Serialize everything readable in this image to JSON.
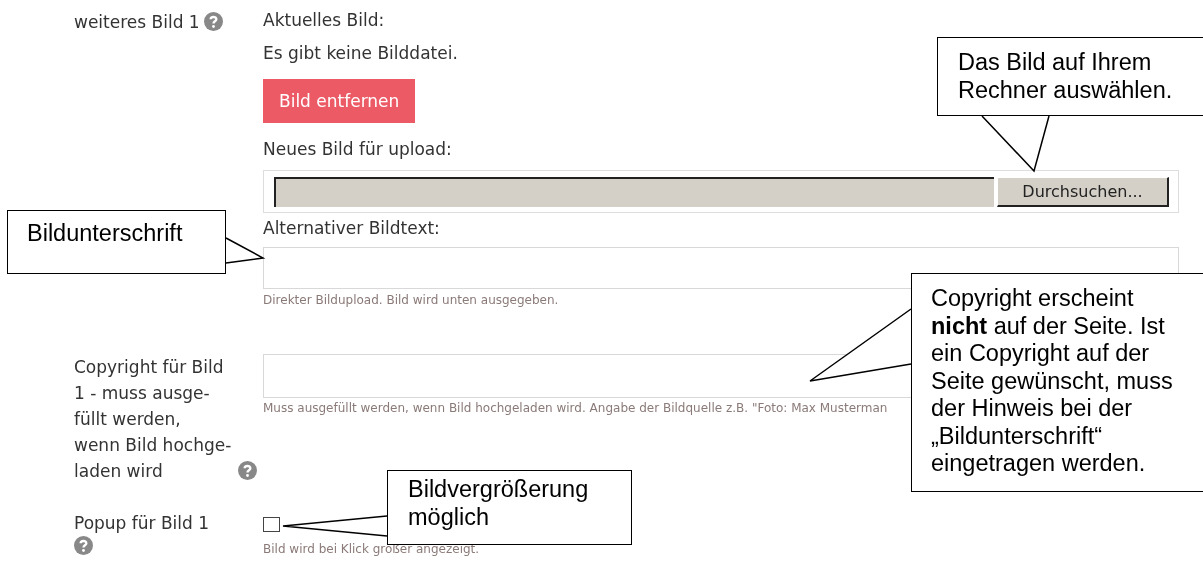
{
  "image_field": {
    "label": "weiteres Bild 1",
    "current_label": "Aktuelles Bild:",
    "current_value": "Es gibt keine Bilddatei.",
    "remove_button": "Bild entfernen",
    "upload_label": "Neues Bild für upload:",
    "browse_button": "Durchsuchen...",
    "alt_label": "Alternativer Bildtext:",
    "hint": "Direkter Bildupload. Bild wird unten ausgegeben."
  },
  "copyright_field": {
    "label": "Copyright für Bild\n1 - muss ausge-\nfüllt werden,\nwenn Bild hochge-\nladen wird",
    "hint": "Muss ausgefüllt werden, wenn Bild hochgeladen wird. Angabe der Bildquelle z.B. \"Foto: Max Musterman"
  },
  "popup_field": {
    "label": "Popup für Bild 1",
    "checked": false,
    "hint": "Bild wird bei Klick größer angezeigt."
  },
  "callouts": [
    {
      "text": "Das Bild auf Ihrem Rechner auswählen."
    },
    {
      "text": "Bildunterschrift"
    },
    {
      "text": "Copyright erscheint **nicht** auf der Seite. Ist ein Copyright auf der Seite gewünscht, muss der Hinweis bei der „Bildunterschrift“ eingetragen werden."
    },
    {
      "text": "Bildvergrößerung möglich"
    }
  ]
}
